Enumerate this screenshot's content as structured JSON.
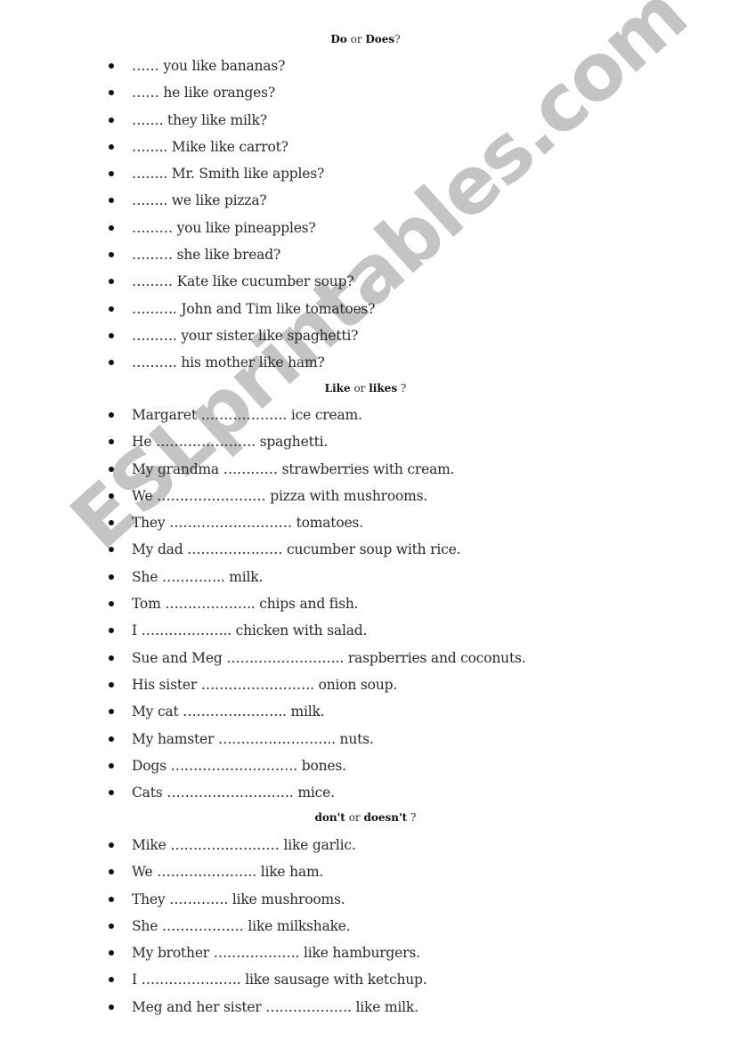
{
  "watermark": "ESLprintables.com",
  "sections": [
    {
      "heading": {
        "a": "Do",
        "or": "or",
        "b": "Does",
        "q": "?"
      },
      "items": [
        "…… you like bananas?",
        "…… he like oranges?",
        "……. they like milk?",
        "…….. Mike like carrot?",
        "…….. Mr. Smith like apples?",
        "…….. we like pizza?",
        "……… you like pineapples?",
        "……… she like bread?",
        "………  Kate like cucumber soup?",
        "………. John and Tim like tomatoes?",
        "………. your sister like spaghetti?",
        "………. his mother like ham?"
      ]
    },
    {
      "heading": {
        "a": "Like",
        "or": "or",
        "b": "likes",
        "q": " ?"
      },
      "items": [
        "Margaret ………………. ice cream.",
        "He …………………. spaghetti.",
        "My grandma …………  strawberries with cream.",
        "We ……………………  pizza with mushrooms.",
        "They ………………………  tomatoes.",
        "My dad …………………  cucumber soup with rice.",
        "She …………..  milk.",
        "Tom ………………..  chips and fish.",
        "I ……………….. chicken with salad.",
        "Sue and Meg ……………………..  raspberries and coconuts.",
        "His sister ……………………. onion soup.",
        "My cat ………………….. milk.",
        "My hamster …………………….. nuts.",
        "Dogs ………………………. bones.",
        "Cats ………………………. mice."
      ]
    },
    {
      "heading": {
        "a": "don't",
        "or": "or",
        "b": "doesn't",
        "q": " ?"
      },
      "items": [
        "Mike …………………… like garlic.",
        "We …………………. like ham.",
        "They …………. like mushrooms.",
        "She ……………… like milkshake.",
        "My brother ………………. like hamburgers.",
        "I …………………. like sausage with ketchup.",
        "Meg and her sister ………………. like milk."
      ]
    }
  ]
}
